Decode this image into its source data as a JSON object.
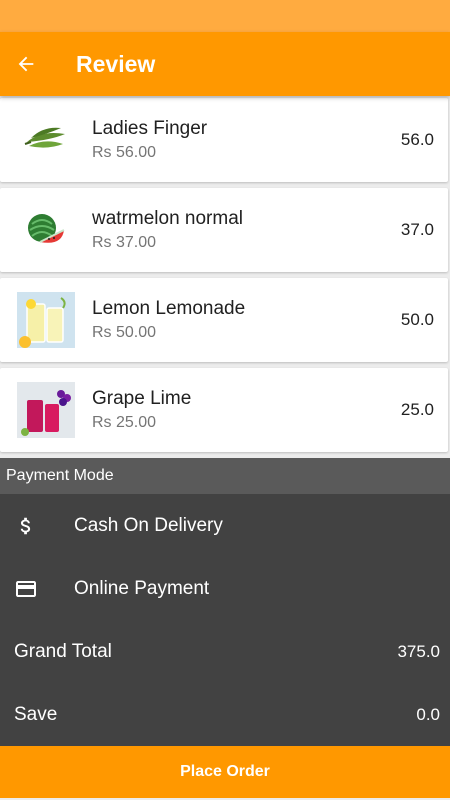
{
  "header": {
    "title": "Review"
  },
  "items": [
    {
      "name": "Ladies Finger",
      "price": "Rs 56.00",
      "qty": "56.0"
    },
    {
      "name": "watrmelon normal",
      "price": "Rs 37.00",
      "qty": "37.0"
    },
    {
      "name": "Lemon Lemonade",
      "price": "Rs 50.00",
      "qty": "50.0"
    },
    {
      "name": "Grape Lime",
      "price": "Rs 25.00",
      "qty": "25.0"
    }
  ],
  "payment": {
    "header": "Payment Mode",
    "options": [
      {
        "label": "Cash On Delivery",
        "icon": "dollar-icon"
      },
      {
        "label": "Online Payment",
        "icon": "credit-card-icon"
      }
    ]
  },
  "totals": {
    "grand_total_label": "Grand Total",
    "grand_total_value": "375.0",
    "save_label": "Save",
    "save_value": "0.0"
  },
  "footer": {
    "place_order_label": "Place Order"
  },
  "colors": {
    "primary": "#ff9800",
    "status_bar": "#ffab40",
    "dark_panel": "#424242",
    "section_header": "#5a5a5a"
  }
}
